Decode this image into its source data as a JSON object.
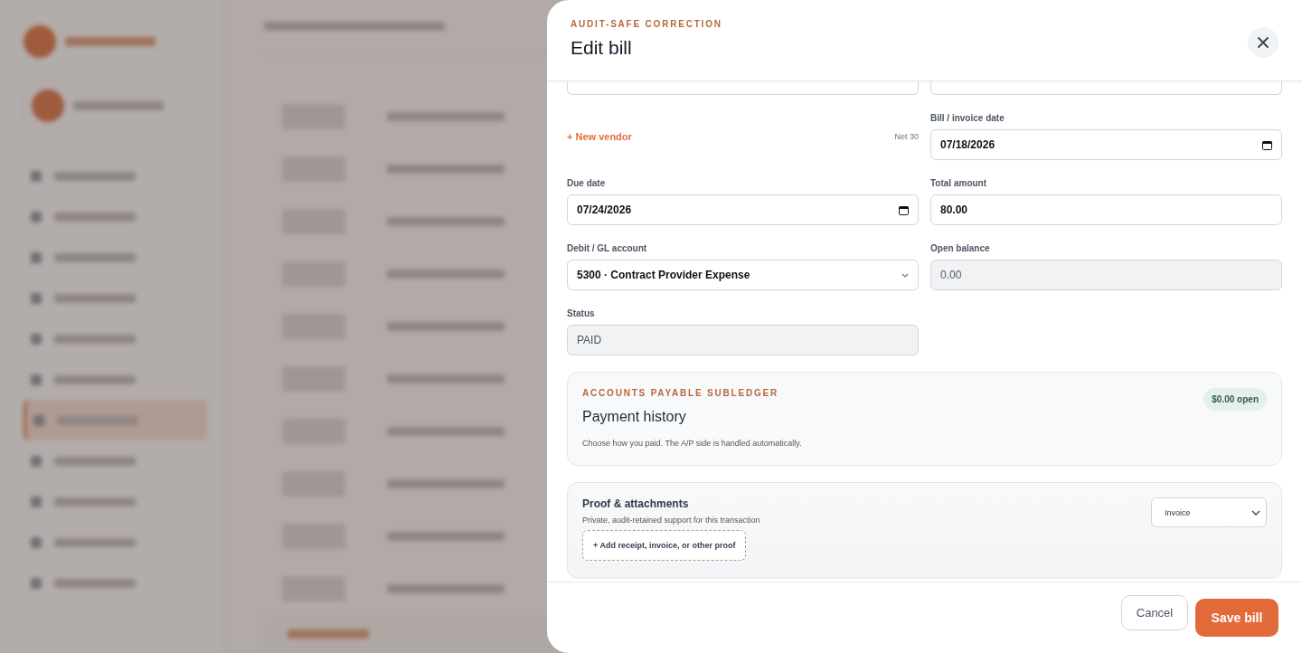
{
  "dialog": {
    "eyebrow": "AUDIT-SAFE CORRECTION",
    "title": "Edit bill",
    "vendor_link": "+ New vendor",
    "terms": "Net 30",
    "fields": [
      {
        "label": "Bill / invoice date",
        "kind": "date",
        "value": "07/18/2026",
        "disabled": false
      },
      {
        "label": "Due date",
        "kind": "date",
        "value": "07/24/2026",
        "disabled": false
      },
      {
        "label": "Total amount",
        "kind": "text",
        "value": "80.00",
        "disabled": false
      },
      {
        "label": "Debit / GL account",
        "kind": "select",
        "value": "5300 · Contract Provider Expense",
        "disabled": false
      },
      {
        "label": "Open balance",
        "kind": "text",
        "value": "0.00",
        "disabled": true
      },
      {
        "label": "Status",
        "kind": "text",
        "value": "PAID",
        "disabled": true
      }
    ],
    "payment": {
      "eyebrow": "ACCOUNTS PAYABLE SUBLEDGER",
      "title": "Payment history",
      "badge": "$0.00 open",
      "note": "Choose how you paid. The A/P side is handled automatically."
    },
    "proof": {
      "title": "Proof & attachments",
      "note": "Private, audit-retained support for this transaction",
      "type": "Invoice",
      "add": "+ Add receipt, invoice, or other proof"
    },
    "buttons": [
      {
        "label": "Cancel",
        "kind": "secondary"
      },
      {
        "label": "Save bill",
        "kind": "primary"
      }
    ]
  }
}
